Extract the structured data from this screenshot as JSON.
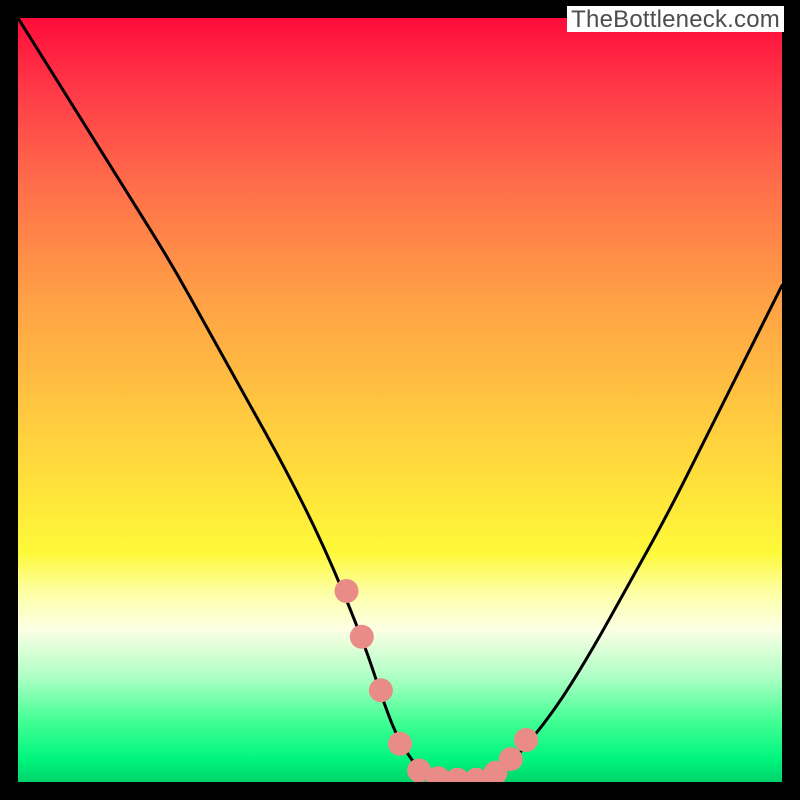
{
  "watermark": "TheBottleneck.com",
  "chart_data": {
    "type": "line",
    "title": "",
    "xlabel": "",
    "ylabel": "",
    "xlim": [
      0,
      100
    ],
    "ylim": [
      0,
      100
    ],
    "series": [
      {
        "name": "curve",
        "x": [
          0,
          5,
          10,
          15,
          20,
          25,
          30,
          35,
          40,
          45,
          48,
          50,
          53,
          56,
          60,
          63,
          65,
          70,
          75,
          80,
          85,
          90,
          95,
          100
        ],
        "values": [
          100,
          92,
          84,
          76,
          68,
          59,
          50,
          41,
          31,
          19,
          10,
          5,
          1,
          0,
          0,
          1,
          3,
          9,
          17,
          26,
          35,
          45,
          55,
          65
        ]
      }
    ],
    "markers": {
      "name": "highlight-points",
      "color": "#e98b87",
      "x": [
        43,
        45,
        47.5,
        50,
        52.5,
        55,
        57.5,
        60,
        62.5,
        64.5,
        66.5
      ],
      "values": [
        25,
        19,
        12,
        5,
        1.5,
        0.5,
        0.3,
        0.3,
        1.2,
        3,
        5.5
      ]
    },
    "background_gradient": {
      "orientation": "vertical",
      "stops": [
        {
          "pos": 0.0,
          "color": "#ff0c3b"
        },
        {
          "pos": 0.36,
          "color": "#ff9e46"
        },
        {
          "pos": 0.64,
          "color": "#ffe93a"
        },
        {
          "pos": 0.8,
          "color": "#fcffe4"
        },
        {
          "pos": 0.97,
          "color": "#00f57e"
        },
        {
          "pos": 1.0,
          "color": "#00d46b"
        }
      ]
    }
  }
}
